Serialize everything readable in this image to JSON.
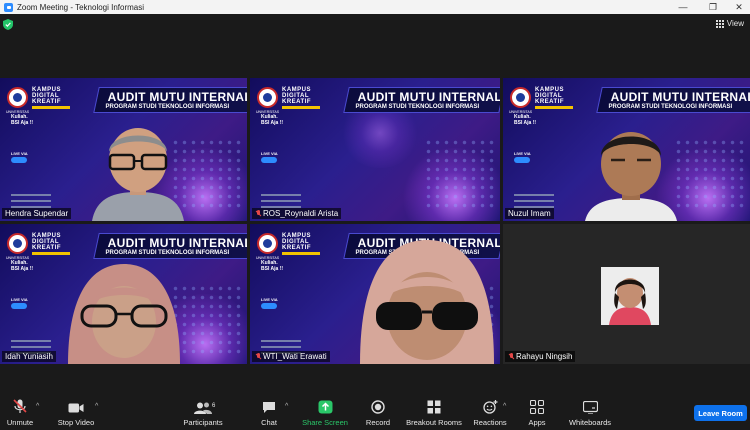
{
  "window": {
    "title": "Zoom Meeting - Teknologi Informasi"
  },
  "topbar": {
    "view_label": "View"
  },
  "slide": {
    "banner_title": "AUDIT MUTU INTERNAL",
    "banner_subtitle": "PROGRAM STUDI TEKNOLOGI INFORMASI",
    "kampus_l1": "KAMPUS",
    "kampus_l2": "DIGITAL",
    "kampus_l3": "KREATIF",
    "univ": "UNIVERSITAS",
    "kuliah_l1": "Kuliah.",
    "kuliah_l2": "BSI Aja !!",
    "live_via": "LIVE VIA"
  },
  "participants": [
    {
      "name": "Hendra Supendar",
      "muted": false
    },
    {
      "name": "ROS_Roynaldi Arista",
      "muted": true
    },
    {
      "name": "Nuzul Imam",
      "muted": false
    },
    {
      "name": "Idah Yuniasih",
      "muted": false
    },
    {
      "name": "WTI_Wati Erawati",
      "muted": true
    },
    {
      "name": "Rahayu Ningsih",
      "muted": true
    }
  ],
  "toolbar": {
    "unmute": "Unmute",
    "stop_video": "Stop Video",
    "participants": "Participants",
    "participants_count": "6",
    "chat": "Chat",
    "share_screen": "Share Screen",
    "record": "Record",
    "breakout_rooms": "Breakout Rooms",
    "reactions": "Reactions",
    "apps": "Apps",
    "whiteboards": "Whiteboards",
    "leave_room": "Leave Room"
  },
  "colors": {
    "active_speaker": "#d3e26b",
    "share_green": "#2ac769",
    "leave_blue": "#0e71eb",
    "muted_red": "#e54848"
  }
}
